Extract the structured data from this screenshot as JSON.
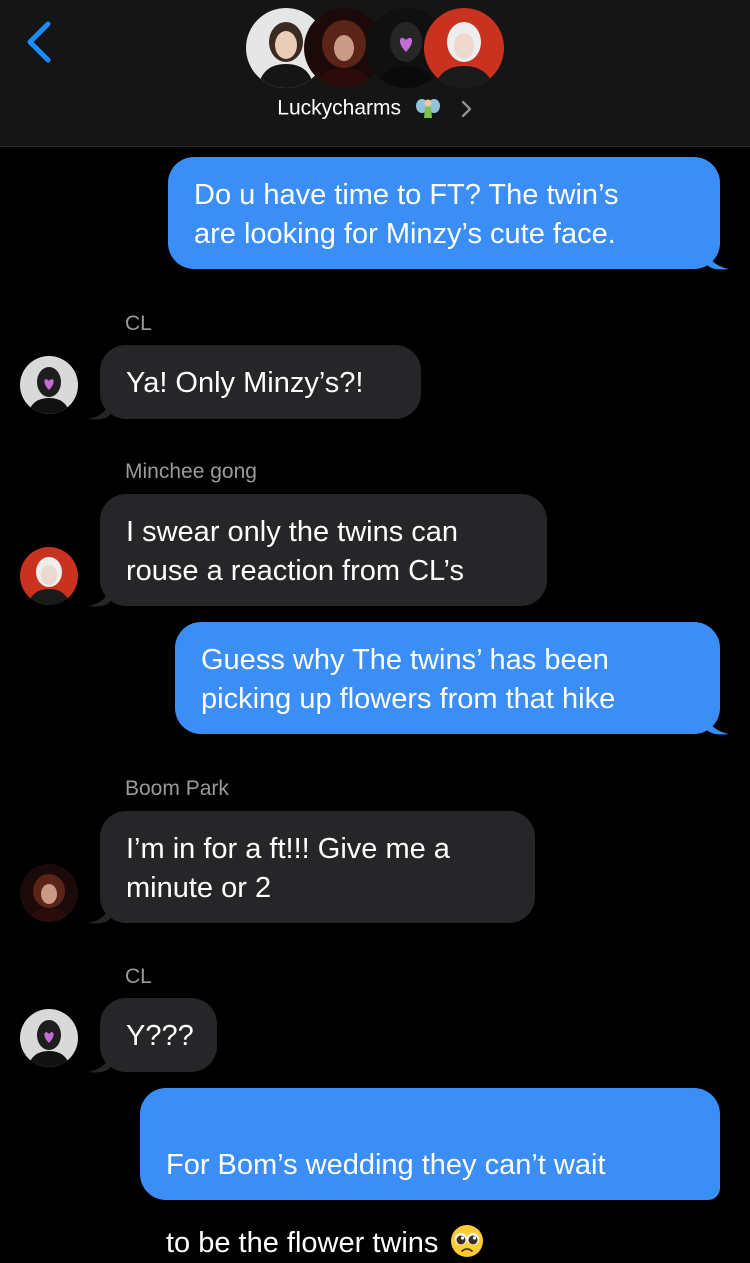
{
  "conversation": {
    "group_name": "Luckycharms"
  },
  "messages": [
    {
      "direction": "out",
      "text": "Do u have time to FT? The twin’s\nare looking for Minzy’s cute face."
    },
    {
      "direction": "in",
      "sender": "CL",
      "text": "Ya! Only Minzy’s?!"
    },
    {
      "direction": "in",
      "sender": "Minchee gong",
      "text": "I swear only the twins can\nrouse a reaction from CL’s"
    },
    {
      "direction": "out",
      "text": "Guess why The twins’ has been\npicking up flowers from that hike"
    },
    {
      "direction": "in",
      "sender": "Boom Park",
      "text": "I’m in for a ft!!! Give me a\nminute or 2"
    },
    {
      "direction": "in",
      "sender": "CL",
      "text": "Y???"
    },
    {
      "direction": "out",
      "text_line1": "For Bom’s wedding they  can’t wait",
      "text_line2": "to be the flower twins",
      "emoji": "pleading-face"
    }
  ],
  "colors": {
    "outgoing": "#3a8ef6",
    "incoming": "#262628",
    "accent": "#1a8cff",
    "sender_label": "#9a9a9e",
    "background": "#000000"
  },
  "icons": {
    "back": "chevron-left-icon",
    "detail": "chevron-right-icon",
    "group_emoji": "fairy-emoji",
    "message_emoji": "pleading-face-emoji"
  }
}
